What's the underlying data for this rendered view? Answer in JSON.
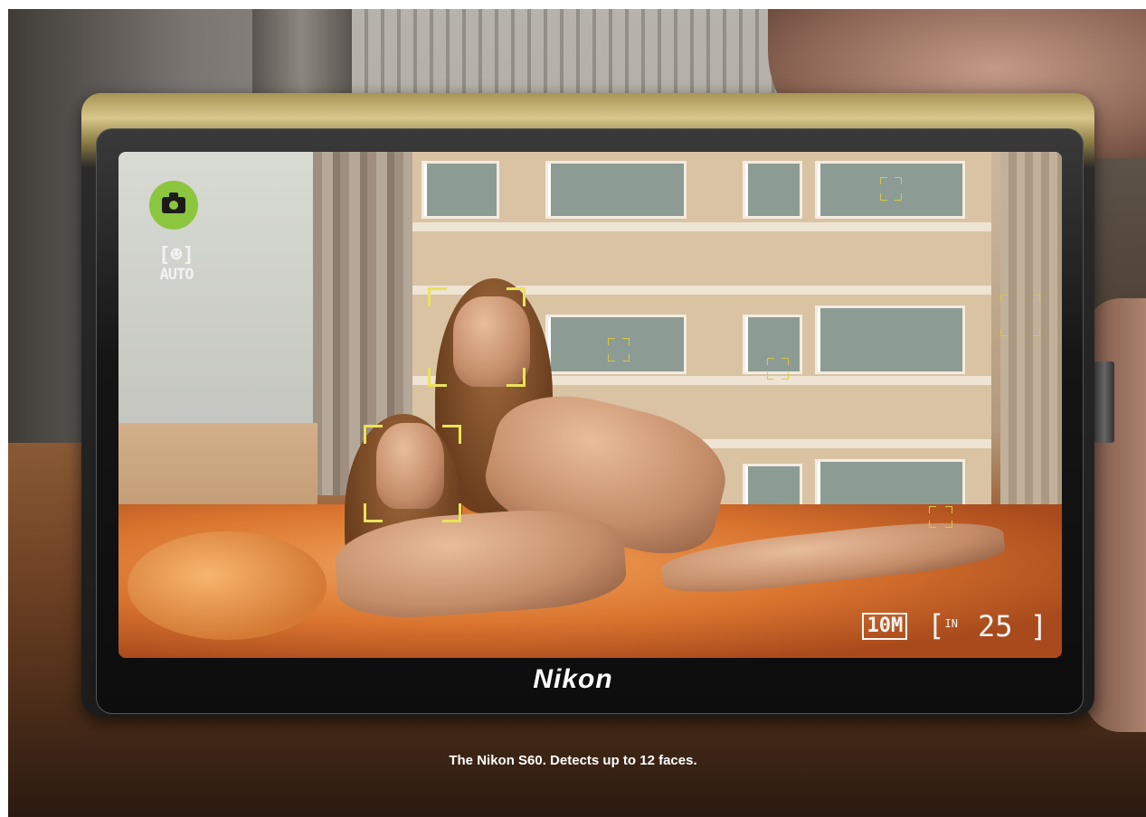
{
  "brand": {
    "logo": "Nikon"
  },
  "tagline": "The Nikon S60. Detects up to 12 faces.",
  "hud": {
    "mode_icon": "camera-icon",
    "face_mode": {
      "brackets": "[☻]",
      "label": "AUTO"
    },
    "resolution_badge": "10M",
    "memory": {
      "open": "[",
      "label": "IN",
      "count": "25",
      "close": "]"
    }
  },
  "face_detection_count": 12,
  "colors": {
    "face_box": "#e9e35a",
    "mode_icon_bg": "#8cc63e",
    "logo": "#ffffff"
  }
}
